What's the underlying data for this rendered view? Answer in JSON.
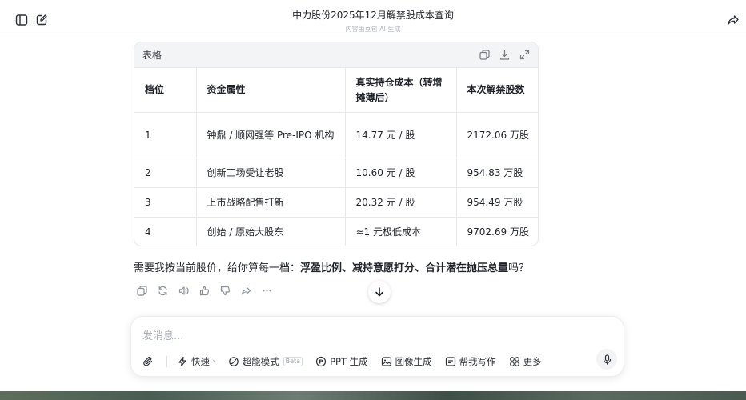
{
  "header": {
    "title": "中力股份2025年12月解禁股成本查询",
    "subtitle": "内容由豆包 AI 生成"
  },
  "table_card": {
    "label": "表格",
    "columns": [
      "档位",
      "资金属性",
      "真实持仓成本（转增摊薄后）",
      "本次解禁股数"
    ],
    "rows": [
      [
        "1",
        "钟鼎 / 顺网强等 Pre-IPO 机构",
        "14.77 元 / 股",
        "2172.06 万股"
      ],
      [
        "2",
        "创新工场受让老股",
        "10.60 元 / 股",
        "954.83 万股"
      ],
      [
        "3",
        "上市战略配售打新",
        "20.32 元 / 股",
        "954.49 万股"
      ],
      [
        "4",
        "创始 / 原始大股东",
        "≈1 元极低成本",
        "9702.69 万股"
      ]
    ]
  },
  "follow_up": {
    "prefix": "需要我按当前股价，给你算每一档：",
    "bold": "浮盈比例、减持意愿打分、合计潜在抛压总量",
    "suffix": "吗？"
  },
  "composer": {
    "placeholder": "发消息...",
    "tools": {
      "fast": "快速",
      "super": "超能模式",
      "beta": "Beta",
      "ppt": "PPT 生成",
      "image": "图像生成",
      "write": "帮我写作",
      "more": "更多"
    }
  },
  "icons": {
    "sidebar": "sidebar-icon",
    "new_chat": "edit-icon",
    "share": "share-icon"
  }
}
